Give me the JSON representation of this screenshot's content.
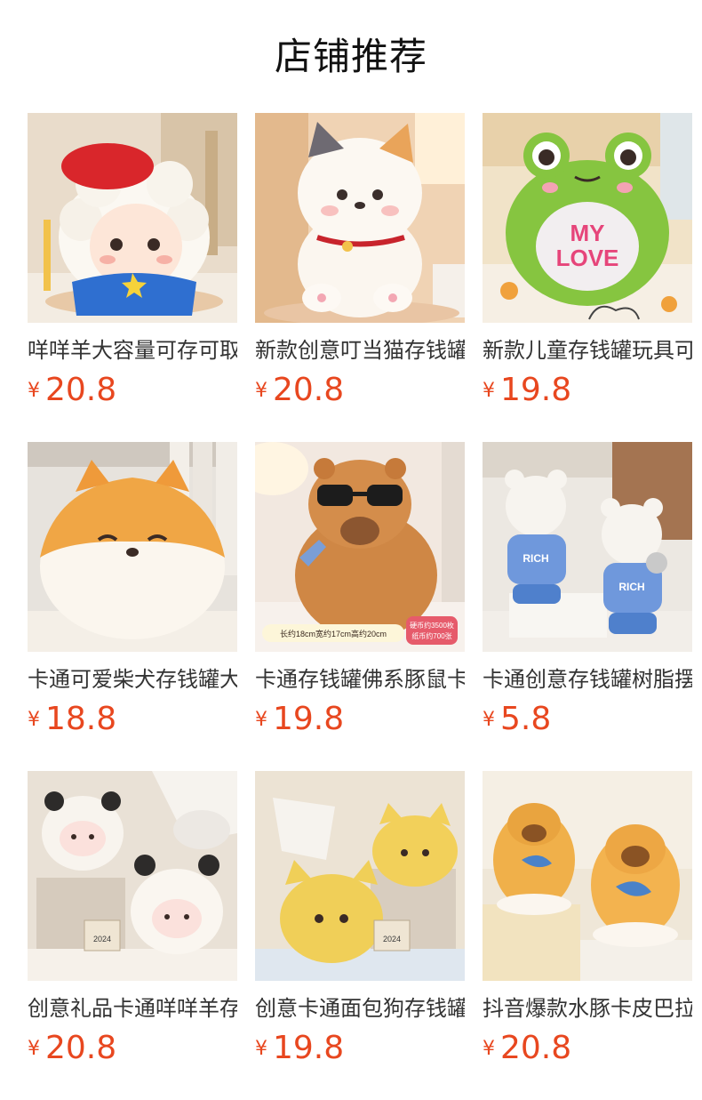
{
  "title": "店铺推荐",
  "currency_symbol": "¥",
  "products": [
    {
      "name": "咩咩羊大容量可存可取",
      "price": "20.8",
      "icon": "lamb-piggy-bank-image"
    },
    {
      "name": "新款创意叮当猫存钱罐",
      "price": "20.8",
      "icon": "cat-piggy-bank-image"
    },
    {
      "name": "新款儿童存钱罐玩具可",
      "price": "19.8",
      "icon": "frog-piggy-bank-image",
      "badge": "MY LOVE"
    },
    {
      "name": "卡通可爱柴犬存钱罐大",
      "price": "18.8",
      "icon": "shiba-piggy-bank-image"
    },
    {
      "name": "卡通存钱罐佛系豚鼠卡",
      "price": "19.8",
      "icon": "capybara-piggy-bank-image",
      "size_text": "长约18cm宽约17cm高约20cm",
      "capacity_text": [
        "硬币约3500枚",
        "纸币约700张"
      ]
    },
    {
      "name": "卡通创意存钱罐树脂摆",
      "price": "5.8",
      "icon": "bear-piggy-bank-image",
      "badge": "RICH"
    },
    {
      "name": "创意礼品卡通咩咩羊存",
      "price": "20.8",
      "icon": "panda-lamb-piggy-bank-image",
      "calendar": "2024"
    },
    {
      "name": "创意卡通面包狗存钱罐",
      "price": "19.8",
      "icon": "bread-dog-piggy-bank-image",
      "calendar": "2024"
    },
    {
      "name": "抖音爆款水豚卡皮巴拉",
      "price": "20.8",
      "icon": "capybara-fish-piggy-bank-image"
    }
  ]
}
